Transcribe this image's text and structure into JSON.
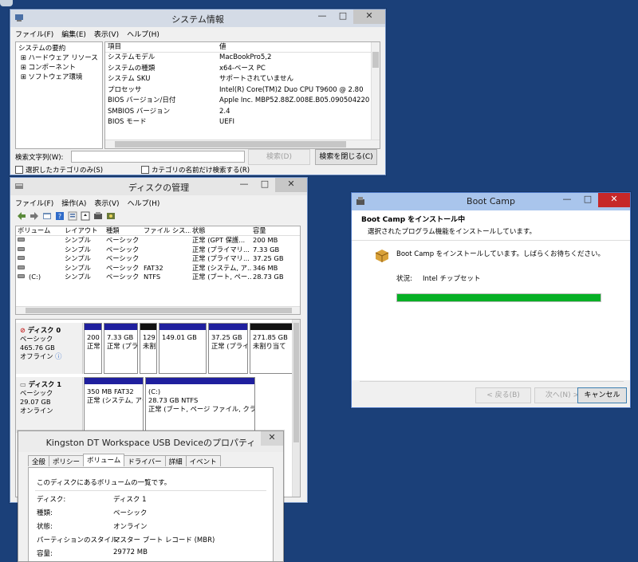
{
  "system_info": {
    "title": "システム情報",
    "menu": [
      "ファイル(F)",
      "編集(E)",
      "表示(V)",
      "ヘルプ(H)"
    ],
    "tree": [
      "システムの要約",
      "ハードウェア リソース",
      "コンポーネント",
      "ソフトウェア環境"
    ],
    "tree_expander": "⊞",
    "columns": [
      "項目",
      "値"
    ],
    "rows": [
      {
        "k": "システムモデル",
        "v": "MacBookPro5,2"
      },
      {
        "k": "システムの種類",
        "v": "x64-ベース PC"
      },
      {
        "k": "システム SKU",
        "v": "サポートされていません"
      },
      {
        "k": "プロセッサ",
        "v": "Intel(R) Core(TM)2 Duo CPU     T9600  @ 2.80"
      },
      {
        "k": "BIOS バージョン/日付",
        "v": "Apple Inc. MBP52.88Z.008E.B05.0905042202,"
      },
      {
        "k": "SMBIOS バージョン",
        "v": "2.4"
      },
      {
        "k": "BIOS モード",
        "v": "UEFI"
      }
    ],
    "search_label": "検索文字列(W):",
    "search_value": "",
    "search_button": "検索(D)",
    "close_search_button": "検索を閉じる(C)",
    "check_selected_only": "選択したカテゴリのみ(S)",
    "check_names_only": "カテゴリの名前だけ検索する(R)"
  },
  "disk_mgmt": {
    "title": "ディスクの管理",
    "menu": [
      "ファイル(F)",
      "操作(A)",
      "表示(V)",
      "ヘルプ(H)"
    ],
    "columns": [
      "ボリューム",
      "レイアウト",
      "種類",
      "ファイル シス...",
      "状態",
      "容量"
    ],
    "volumes": [
      {
        "vol": "",
        "layout": "シンプル",
        "type": "ベーシック",
        "fs": "",
        "status": "正常 (GPT 保護...",
        "cap": "200 MB"
      },
      {
        "vol": "",
        "layout": "シンプル",
        "type": "ベーシック",
        "fs": "",
        "status": "正常 (プライマリ...",
        "cap": "7.33 GB"
      },
      {
        "vol": "",
        "layout": "シンプル",
        "type": "ベーシック",
        "fs": "",
        "status": "正常 (プライマリ...",
        "cap": "37.25 GB"
      },
      {
        "vol": "",
        "layout": "シンプル",
        "type": "ベーシック",
        "fs": "FAT32",
        "status": "正常 (システム, ア...",
        "cap": "346 MB"
      },
      {
        "vol": "(C:)",
        "layout": "シンプル",
        "type": "ベーシック",
        "fs": "NTFS",
        "status": "正常 (ブート, ペー...",
        "cap": "28.73 GB"
      }
    ],
    "disk0": {
      "name": "ディスク 0",
      "type": "ベーシック",
      "size": "465.76 GB",
      "state": "オフライン",
      "parts": [
        {
          "l1": "200",
          "l2": "正常"
        },
        {
          "l1": "7.33 GB",
          "l2": "正常 (プラ"
        },
        {
          "l1": "129",
          "l2": "未割"
        },
        {
          "l1": "149.01 GB",
          "l2": ""
        },
        {
          "l1": "37.25 GB",
          "l2": "正常 (プライ"
        },
        {
          "l1": "271.85 GB",
          "l2": "未割り当て"
        }
      ]
    },
    "disk1": {
      "name": "ディスク 1",
      "type": "ベーシック",
      "size": "29.07 GB",
      "state": "オンライン",
      "parts": [
        {
          "l0": "",
          "l1": "350 MB FAT32",
          "l2": "正常 (システム, アク"
        },
        {
          "l0": "(C:)",
          "l1": "28.73 GB NTFS",
          "l2": "正常 (ブート, ページ ファイル, クラッシ"
        }
      ]
    }
  },
  "properties": {
    "title": "Kingston DT Workspace USB Deviceのプロパティ",
    "tabs": [
      "全般",
      "ポリシー",
      "ボリューム",
      "ドライバー",
      "詳細",
      "イベント"
    ],
    "active_tab": "ボリューム",
    "intro": "このディスクにあるボリュームの一覧です。",
    "fields": [
      {
        "label": "ディスク:",
        "value": "ディスク 1"
      },
      {
        "label": "種類:",
        "value": "ベーシック"
      },
      {
        "label": "状態:",
        "value": "オンライン"
      },
      {
        "label": "パーティションのスタイル:",
        "value": "マスター ブート レコード (MBR)"
      },
      {
        "label": "容量:",
        "value": "29772 MB"
      }
    ]
  },
  "bootcamp": {
    "title": "Boot Camp",
    "heading": "Boot Camp をインストール中",
    "subheading": "選択されたプログラム機能をインストールしています。",
    "message": "Boot Camp をインストールしています。しばらくお待ちください。",
    "status_label": "状況:",
    "status_value": "Intel チップセット",
    "progress": 1.0,
    "back_button": "< 戻る(B)",
    "next_button": "次へ(N) >",
    "cancel_button": "キャンセル"
  },
  "colors": {
    "desktop": "#1b4079",
    "progress": "#06b025",
    "partition_bar": "#1f1f9e"
  }
}
